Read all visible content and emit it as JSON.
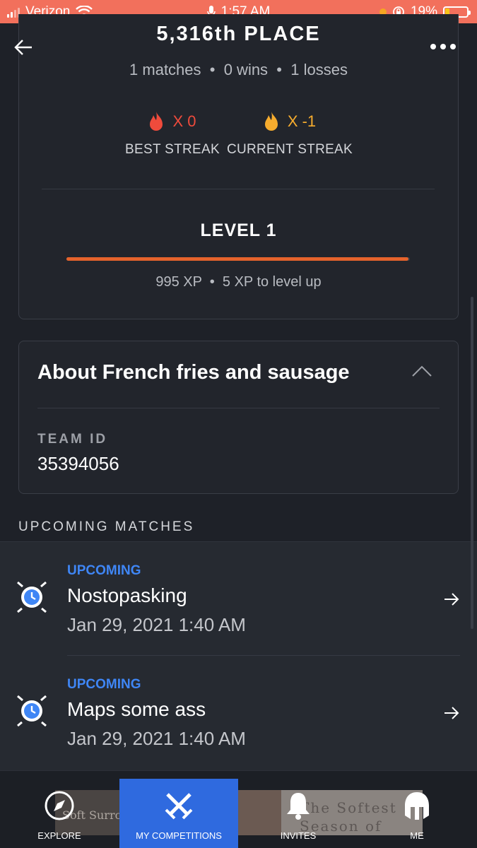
{
  "status_bar": {
    "carrier": "Verizon",
    "time": "1:57 AM",
    "battery_percent": "19%",
    "battery_level": 0.19,
    "accent_color": "#f2705c"
  },
  "header": {
    "place": "5,316th PLACE",
    "matches": "1 matches",
    "wins": "0 wins",
    "losses": "1 losses",
    "separator": "•"
  },
  "streaks": {
    "best": {
      "value": "X 0",
      "label": "BEST STREAK",
      "color": "#ef4b3c"
    },
    "current": {
      "value": "X -1",
      "label": "CURRENT STREAK",
      "color": "#f6ac2e"
    }
  },
  "level": {
    "title": "LEVEL 1",
    "xp": "995 XP",
    "to_level_up": "5 XP to level up",
    "progress_fraction": 0.995,
    "bar_color": "#e5632c"
  },
  "about": {
    "title": "About French fries and sausage",
    "team_id_label": "TEAM ID",
    "team_id_value": "35394056"
  },
  "upcoming": {
    "section_label": "UPCOMING MATCHES",
    "matches": [
      {
        "status": "UPCOMING",
        "name": "Nostopasking",
        "date": "Jan 29, 2021 1:40 AM"
      },
      {
        "status": "UPCOMING",
        "name": "Maps some ass",
        "date": "Jan 29, 2021 1:40 AM"
      }
    ],
    "status_color": "#3f86f5"
  },
  "bottom_nav": {
    "items": [
      {
        "label": "EXPLORE",
        "icon": "compass-icon"
      },
      {
        "label": "MY COMPETITIONS",
        "icon": "crossed-swords-icon",
        "active": true
      },
      {
        "label": "INVITES",
        "icon": "bell-icon"
      },
      {
        "label": "ME",
        "icon": "helmet-icon"
      }
    ],
    "active_color": "#2f6adf"
  },
  "ad_banner": {
    "left_text": "Soft Surro",
    "right_text": "The Softest Season of All"
  }
}
